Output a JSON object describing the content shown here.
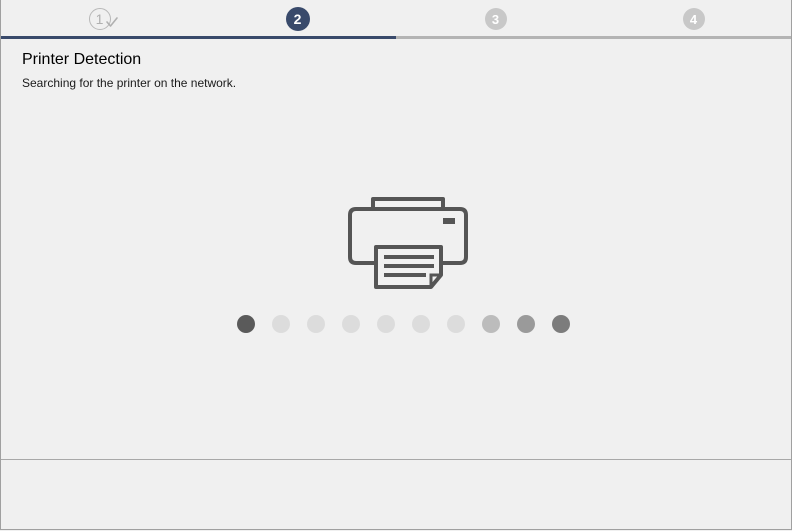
{
  "wizard": {
    "progress_fraction": 0.5,
    "steps": [
      {
        "number": "1",
        "state": "done"
      },
      {
        "number": "2",
        "state": "active"
      },
      {
        "number": "3",
        "state": "pending"
      },
      {
        "number": "4",
        "state": "pending"
      }
    ]
  },
  "page": {
    "title": "Printer Detection",
    "subtitle": "Searching for the printer on the network."
  },
  "icons": {
    "main": "printer-icon",
    "done_step": "check-icon"
  },
  "loader": {
    "dot_count": 10,
    "dot_colors": [
      "#5a5a5a",
      "#dcdcdc",
      "#dcdcdc",
      "#dcdcdc",
      "#dcdcdc",
      "#dcdcdc",
      "#dcdcdc",
      "#bcbcbc",
      "#9a9a9a",
      "#7c7c7c"
    ]
  },
  "colors": {
    "accent": "#394a6b",
    "track": "#b4b4b4",
    "background": "#f0f0f0",
    "icon": "#555555"
  }
}
